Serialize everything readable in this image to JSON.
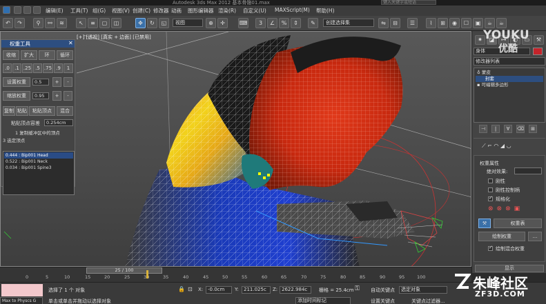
{
  "titlebar": {
    "title": "Autodesk 3ds Max  2012    基本骨骼01.max",
    "search_placeholder": "键入关键字或短语"
  },
  "menu": [
    "编辑(E)",
    "工具(T)",
    "组(G)",
    "视图(V)",
    "创建(C)",
    "修改器",
    "动画",
    "图形编辑器",
    "渲染(R)",
    "自定义(U)",
    "MAXScript(M)",
    "帮助(H)"
  ],
  "toolbar": {
    "view_dropdown": "视图",
    "selection_set": "创建选择集"
  },
  "viewport": {
    "label": "[+] [透视] [真实 + 边面] [已禁用]"
  },
  "weight_tool": {
    "title": "权重工具",
    "row1": [
      "收缩",
      "扩大",
      "环",
      "循环"
    ],
    "presets": [
      ".0",
      ".1",
      ".25",
      ".5",
      ".75",
      ".9",
      "1"
    ],
    "set_weight_label": "设置权重",
    "set_weight_value": "0.5",
    "scale_weight_label": "缩放权重",
    "scale_weight_value": "0.95",
    "row3": [
      "复制",
      "粘贴",
      "粘贴顶点",
      "混合"
    ],
    "tolerance_label": "粘贴顶点容差",
    "tolerance_value": "0.254cm",
    "buffer_text": "1 复制缓冲区中的顶点",
    "selected_text": "3 选定顶点",
    "list": [
      {
        "text": "0.444 : Bip001 Head",
        "selected": true
      },
      {
        "text": "0.522 : Bip001 Neck",
        "selected": false
      },
      {
        "text": "0.034 : Bip001 Spine3",
        "selected": false
      }
    ]
  },
  "command_panel": {
    "object_name": "身体",
    "object_color": "#c4242b",
    "modifier_list": "修改器列表",
    "stack": [
      {
        "text": "蒙皮",
        "selected": false
      },
      {
        "text": "封套",
        "selected": true
      },
      {
        "text": "可编辑多边形",
        "selected": false
      }
    ],
    "weight_props_title": "权重属性",
    "abs_effect_label": "绝对效果:",
    "checks": [
      {
        "label": "刚性",
        "on": false
      },
      {
        "label": "刚性控制柄",
        "on": false
      },
      {
        "label": "规格化",
        "on": true
      }
    ],
    "weight_table_btn": "权重表",
    "paint_weights_btn": "绘制权重",
    "paint_blend_label": "绘制混合权重",
    "display_label": "显示"
  },
  "timeline": {
    "slider_label": "25 / 100",
    "ticks": [
      "0",
      "5",
      "10",
      "15",
      "20",
      "25",
      "30",
      "35",
      "40",
      "45",
      "50",
      "55",
      "60",
      "65",
      "70",
      "75",
      "80",
      "85",
      "90",
      "95",
      "100"
    ]
  },
  "status": {
    "script_label": "Max to Physcs G",
    "selected_text": "选择了 1 个 对象",
    "hint_text": "单击或单击并拖动以选择对象",
    "x_label": "X:",
    "x_value": "-0.0cm",
    "y_label": "Y:",
    "y_value": "211.025c",
    "z_label": "Z:",
    "z_value": "2622.984c",
    "grid_text": "栅格 = 25.4cm",
    "add_time_tag": "添加时间标记",
    "auto_key": "自动关键点",
    "selected_obj": "选定对象",
    "set_key": "设置关键点",
    "key_filter": "关键点过滤器..."
  },
  "watermarks": {
    "youku": "YOUKU",
    "youku_cn": "优酷",
    "zf3d_cn": "朱峰社区",
    "zf3d_url": "ZF3D.COM"
  }
}
